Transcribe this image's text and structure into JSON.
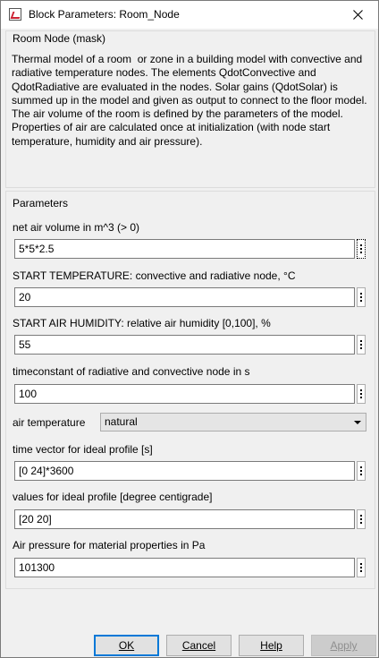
{
  "window": {
    "title": "Block Parameters: Room_Node"
  },
  "description": {
    "group_title": "Room Node (mask)",
    "text": "Thermal model of a room  or zone in a building model with convective and radiative temperature nodes. The elements QdotConvective and QdotRadiative are evaluated in the nodes. Solar gains (QdotSolar) is summed up in the model and given as output to connect to the floor model.\nThe air volume of the room is defined by the parameters of the model. Properties of air are calculated once at initialization (with node start temperature, humidity and air pressure)."
  },
  "parameters": {
    "group_title": "Parameters",
    "air_volume": {
      "label": "net air volume in m^3 (> 0)",
      "value": "5*5*2.5"
    },
    "start_temperature": {
      "label": "START TEMPERATURE: convective and radiative node, °C",
      "value": "20"
    },
    "start_humidity": {
      "label": "START AIR HUMIDITY: relative air humidity [0,100], %",
      "value": "55"
    },
    "timeconstant": {
      "label": "timeconstant of radiative and convective node in s",
      "value": "100"
    },
    "air_temperature": {
      "label": "air temperature",
      "selected": "natural"
    },
    "time_vector": {
      "label": "time vector for ideal profile [s]",
      "value": "[0 24]*3600"
    },
    "profile_values": {
      "label": "values for ideal profile [degree centigrade]",
      "value": "[20 20]"
    },
    "air_pressure": {
      "label": "Air pressure for material properties in Pa",
      "value": "101300"
    }
  },
  "buttons": {
    "ok": "OK",
    "cancel": "Cancel",
    "help": "Help",
    "apply": "Apply"
  }
}
